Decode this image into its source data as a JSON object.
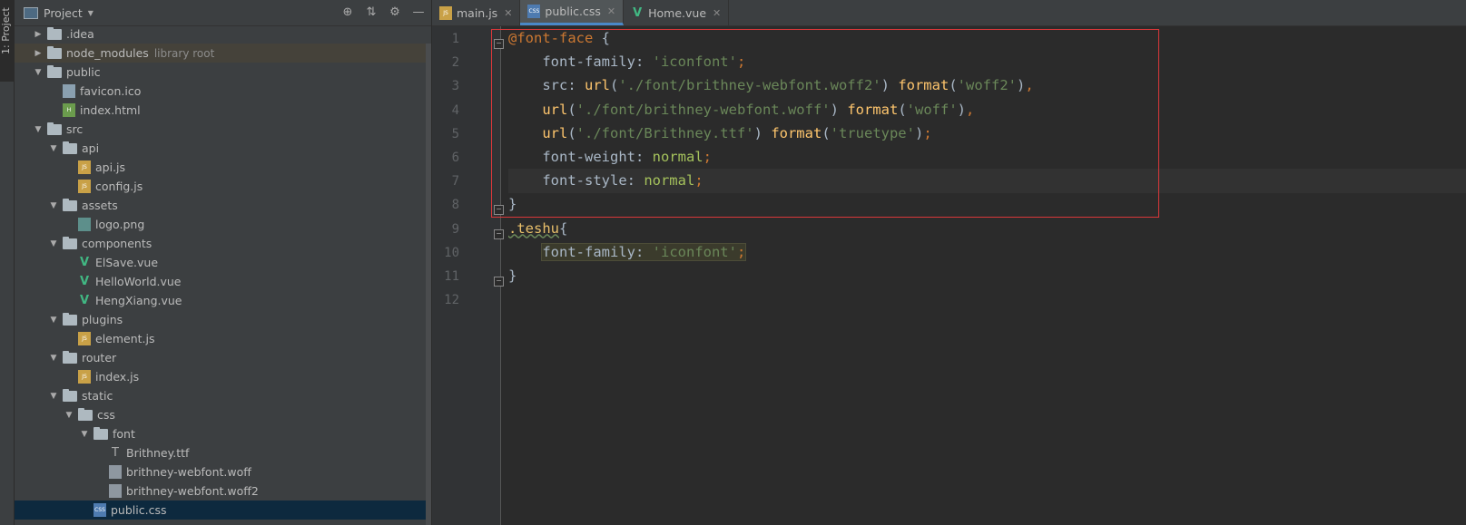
{
  "sidebar_tab": "1: Project",
  "project": {
    "title": "Project",
    "tree": [
      {
        "label": "idea",
        "prefix": ".",
        "kind": "folder",
        "depth": 0,
        "expanded": false
      },
      {
        "label": "node_modules",
        "sub": "library root",
        "kind": "folder",
        "depth": 0,
        "expanded": false,
        "lib": true
      },
      {
        "label": "public",
        "kind": "folder",
        "depth": 0,
        "expanded": true
      },
      {
        "label": "favicon.ico",
        "kind": "ico",
        "depth": 1
      },
      {
        "label": "index.html",
        "kind": "html",
        "depth": 1
      },
      {
        "label": "src",
        "kind": "folder",
        "depth": 0,
        "expanded": true
      },
      {
        "label": "api",
        "kind": "folder",
        "depth": 1,
        "expanded": true
      },
      {
        "label": "api.js",
        "kind": "js",
        "depth": 2
      },
      {
        "label": "config.js",
        "kind": "js",
        "depth": 2
      },
      {
        "label": "assets",
        "kind": "folder",
        "depth": 1,
        "expanded": true
      },
      {
        "label": "logo.png",
        "kind": "png",
        "depth": 2
      },
      {
        "label": "components",
        "kind": "folder",
        "depth": 1,
        "expanded": true
      },
      {
        "label": "ElSave.vue",
        "kind": "vue",
        "depth": 2
      },
      {
        "label": "HelloWorld.vue",
        "kind": "vue",
        "depth": 2
      },
      {
        "label": "HengXiang.vue",
        "kind": "vue",
        "depth": 2
      },
      {
        "label": "plugins",
        "kind": "folder",
        "depth": 1,
        "expanded": true
      },
      {
        "label": "element.js",
        "kind": "js",
        "depth": 2
      },
      {
        "label": "router",
        "kind": "folder",
        "depth": 1,
        "expanded": true
      },
      {
        "label": "index.js",
        "kind": "js",
        "depth": 2
      },
      {
        "label": "static",
        "kind": "folder",
        "depth": 1,
        "expanded": true
      },
      {
        "label": "css",
        "kind": "folder",
        "depth": 2,
        "expanded": true
      },
      {
        "label": "font",
        "kind": "folder",
        "depth": 3,
        "expanded": true
      },
      {
        "label": "Brithney.ttf",
        "kind": "font",
        "depth": 4
      },
      {
        "label": "brithney-webfont.woff",
        "kind": "woff",
        "depth": 4
      },
      {
        "label": "brithney-webfont.woff2",
        "kind": "woff",
        "depth": 4
      },
      {
        "label": "public.css",
        "kind": "css",
        "depth": 3,
        "selected": true
      }
    ]
  },
  "tabs": [
    {
      "label": "main.js",
      "icon": "js",
      "active": false
    },
    {
      "label": "public.css",
      "icon": "css",
      "active": true
    },
    {
      "label": "Home.vue",
      "icon": "vue",
      "active": false
    }
  ],
  "icon_text": {
    "js": "JS",
    "css": "CSS",
    "html": "H",
    "font": "T",
    "vue": "V"
  },
  "code_lines": [
    "@font-face {",
    "    font-family: 'iconfont';",
    "    src: url('./font/brithney-webfont.woff2') format('woff2'),",
    "    url('./font/brithney-webfont.woff') format('woff'),",
    "    url('./font/Brithney.ttf') format('truetype');",
    "    font-weight: normal;",
    "    font-style: normal;",
    "}",
    ".teshu{",
    "    font-family: 'iconfont';",
    "}",
    ""
  ],
  "colors": {
    "accent": "#4a88c7",
    "highlight_box": "#d9373a",
    "selection": "#0d293e"
  }
}
